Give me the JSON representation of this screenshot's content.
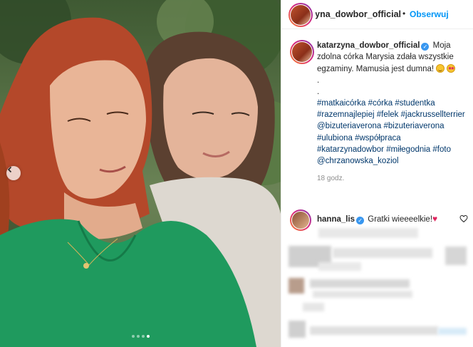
{
  "header": {
    "username": "katarzyna_dowbor_official",
    "separator": "•",
    "follow_label": "Obserwuj"
  },
  "caption": {
    "username": "katarzyna_dowbor_official",
    "text": "Moja zdolna córka Marysia zdała wszystkie egzaminy. Mamusia jest dumna!",
    "dots": [
      ".",
      "."
    ],
    "hashtags": [
      "#matkaicórka",
      "#córka",
      "#studentka",
      "#razemnajlepiej",
      "#felek",
      "#jackrussellterrier",
      "@bizuteriaverona",
      "#bizuteriaverona",
      "#ulubiona",
      "#współpraca",
      "#katarzynadowbor",
      "#miłegodnia",
      "#foto",
      "@chrzanowska_koziol"
    ],
    "timestamp": "18 godz."
  },
  "comment": {
    "username": "hanna_lis",
    "text": "Gratki wieeeelkie!"
  },
  "carousel": {
    "dot_count": 4,
    "active_index": 3
  },
  "icons": {
    "previous": "chevron-left-icon",
    "verified": "verified-badge-icon",
    "like": "heart-outline-icon"
  },
  "colors": {
    "accent": "#0095f6",
    "verified": "#3897f0",
    "hashtag": "#00376b",
    "heart": "#e0245e",
    "sweater": "#1f9a5e"
  }
}
